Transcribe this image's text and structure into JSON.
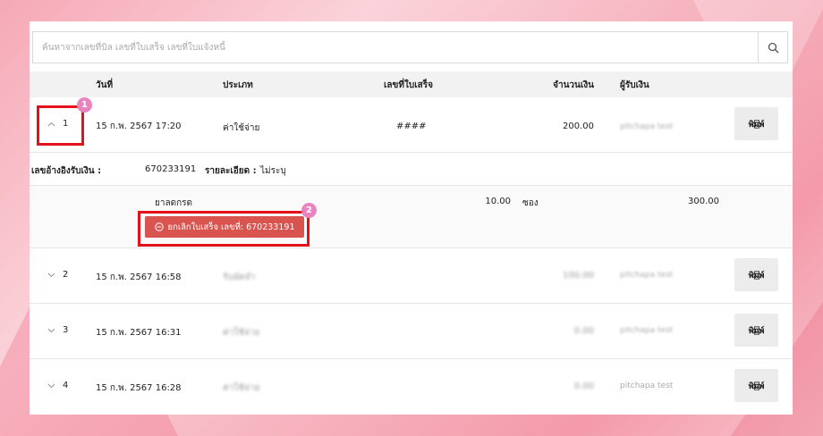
{
  "search": {
    "placeholder": "ค้นหาจากเลขที่บิล เลขที่ใบเสร็จ เลขที่ใบแจ้งหนี้",
    "value": ""
  },
  "table": {
    "headers": {
      "date": "วันที่",
      "type": "ประเภท",
      "receipt_no": "เลขที่ใบเสร็จ",
      "amount": "จำนวนเงิน",
      "receiver": "ผู้รับเงิน"
    },
    "print_label": "พิมพ์",
    "rows": [
      {
        "index": "1",
        "date": "15 ก.พ. 2567 17:20",
        "type": "ค่าใช้จ่าย",
        "receipt_no": "####",
        "amount": "200.00",
        "receiver": "pitchapa test",
        "expanded": true
      },
      {
        "index": "2",
        "date": "15 ก.พ. 2567 16:58",
        "type": "รับมัดจำ",
        "receipt_no": "",
        "amount": "100.00",
        "receiver": "pitchapa test",
        "expanded": false
      },
      {
        "index": "3",
        "date": "15 ก.พ. 2567 16:31",
        "type": "ค่าใช้จ่าย",
        "receipt_no": "",
        "amount": "0.00",
        "receiver": "pitchapa test",
        "expanded": false
      },
      {
        "index": "4",
        "date": "15 ก.พ. 2567 16:28",
        "type": "ค่าใช้จ่าย",
        "receipt_no": "",
        "amount": "0.00",
        "receiver": "pitchapa test",
        "expanded": false
      }
    ]
  },
  "detail": {
    "ref_label": "เลขอ้างอิงรับเงิน :",
    "ref_value": "670233191",
    "desc_label": "รายละเอียด :",
    "desc_value": "ไม่ระบุ",
    "item": {
      "name": "ยาลดกรด",
      "qty": "10.00",
      "unit": "ซอง",
      "total": "300.00"
    },
    "cancel_button": "ยกเลิกใบเสร็จ เลขที่: 670233191"
  },
  "annotations": {
    "badge_1": "1",
    "badge_2": "2"
  },
  "colors": {
    "cancel": "#d9534f",
    "highlight": "#e3121a",
    "badge": "#e884bf"
  }
}
